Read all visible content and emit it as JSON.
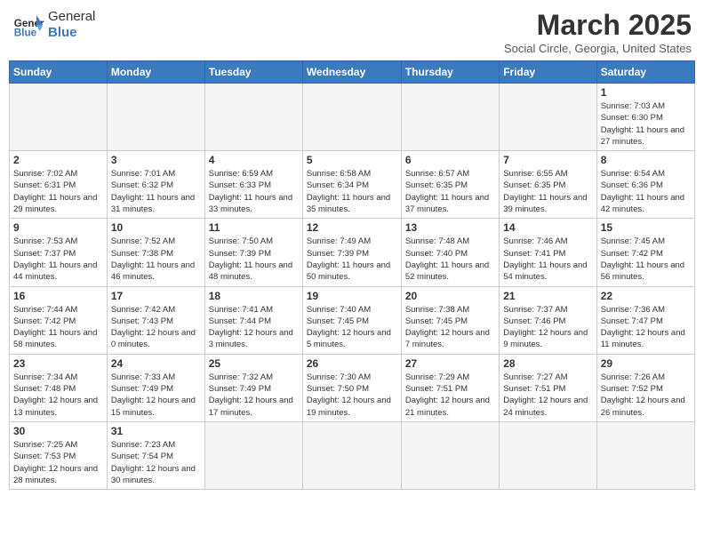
{
  "header": {
    "logo_text_normal": "General",
    "logo_text_blue": "Blue",
    "month_title": "March 2025",
    "location": "Social Circle, Georgia, United States"
  },
  "days_of_week": [
    "Sunday",
    "Monday",
    "Tuesday",
    "Wednesday",
    "Thursday",
    "Friday",
    "Saturday"
  ],
  "weeks": [
    [
      {
        "num": "",
        "info": ""
      },
      {
        "num": "",
        "info": ""
      },
      {
        "num": "",
        "info": ""
      },
      {
        "num": "",
        "info": ""
      },
      {
        "num": "",
        "info": ""
      },
      {
        "num": "",
        "info": ""
      },
      {
        "num": "1",
        "info": "Sunrise: 7:03 AM\nSunset: 6:30 PM\nDaylight: 11 hours and 27 minutes."
      }
    ],
    [
      {
        "num": "2",
        "info": "Sunrise: 7:02 AM\nSunset: 6:31 PM\nDaylight: 11 hours and 29 minutes."
      },
      {
        "num": "3",
        "info": "Sunrise: 7:01 AM\nSunset: 6:32 PM\nDaylight: 11 hours and 31 minutes."
      },
      {
        "num": "4",
        "info": "Sunrise: 6:59 AM\nSunset: 6:33 PM\nDaylight: 11 hours and 33 minutes."
      },
      {
        "num": "5",
        "info": "Sunrise: 6:58 AM\nSunset: 6:34 PM\nDaylight: 11 hours and 35 minutes."
      },
      {
        "num": "6",
        "info": "Sunrise: 6:57 AM\nSunset: 6:35 PM\nDaylight: 11 hours and 37 minutes."
      },
      {
        "num": "7",
        "info": "Sunrise: 6:55 AM\nSunset: 6:35 PM\nDaylight: 11 hours and 39 minutes."
      },
      {
        "num": "8",
        "info": "Sunrise: 6:54 AM\nSunset: 6:36 PM\nDaylight: 11 hours and 42 minutes."
      }
    ],
    [
      {
        "num": "9",
        "info": "Sunrise: 7:53 AM\nSunset: 7:37 PM\nDaylight: 11 hours and 44 minutes."
      },
      {
        "num": "10",
        "info": "Sunrise: 7:52 AM\nSunset: 7:38 PM\nDaylight: 11 hours and 46 minutes."
      },
      {
        "num": "11",
        "info": "Sunrise: 7:50 AM\nSunset: 7:39 PM\nDaylight: 11 hours and 48 minutes."
      },
      {
        "num": "12",
        "info": "Sunrise: 7:49 AM\nSunset: 7:39 PM\nDaylight: 11 hours and 50 minutes."
      },
      {
        "num": "13",
        "info": "Sunrise: 7:48 AM\nSunset: 7:40 PM\nDaylight: 11 hours and 52 minutes."
      },
      {
        "num": "14",
        "info": "Sunrise: 7:46 AM\nSunset: 7:41 PM\nDaylight: 11 hours and 54 minutes."
      },
      {
        "num": "15",
        "info": "Sunrise: 7:45 AM\nSunset: 7:42 PM\nDaylight: 11 hours and 56 minutes."
      }
    ],
    [
      {
        "num": "16",
        "info": "Sunrise: 7:44 AM\nSunset: 7:42 PM\nDaylight: 11 hours and 58 minutes."
      },
      {
        "num": "17",
        "info": "Sunrise: 7:42 AM\nSunset: 7:43 PM\nDaylight: 12 hours and 0 minutes."
      },
      {
        "num": "18",
        "info": "Sunrise: 7:41 AM\nSunset: 7:44 PM\nDaylight: 12 hours and 3 minutes."
      },
      {
        "num": "19",
        "info": "Sunrise: 7:40 AM\nSunset: 7:45 PM\nDaylight: 12 hours and 5 minutes."
      },
      {
        "num": "20",
        "info": "Sunrise: 7:38 AM\nSunset: 7:45 PM\nDaylight: 12 hours and 7 minutes."
      },
      {
        "num": "21",
        "info": "Sunrise: 7:37 AM\nSunset: 7:46 PM\nDaylight: 12 hours and 9 minutes."
      },
      {
        "num": "22",
        "info": "Sunrise: 7:36 AM\nSunset: 7:47 PM\nDaylight: 12 hours and 11 minutes."
      }
    ],
    [
      {
        "num": "23",
        "info": "Sunrise: 7:34 AM\nSunset: 7:48 PM\nDaylight: 12 hours and 13 minutes."
      },
      {
        "num": "24",
        "info": "Sunrise: 7:33 AM\nSunset: 7:49 PM\nDaylight: 12 hours and 15 minutes."
      },
      {
        "num": "25",
        "info": "Sunrise: 7:32 AM\nSunset: 7:49 PM\nDaylight: 12 hours and 17 minutes."
      },
      {
        "num": "26",
        "info": "Sunrise: 7:30 AM\nSunset: 7:50 PM\nDaylight: 12 hours and 19 minutes."
      },
      {
        "num": "27",
        "info": "Sunrise: 7:29 AM\nSunset: 7:51 PM\nDaylight: 12 hours and 21 minutes."
      },
      {
        "num": "28",
        "info": "Sunrise: 7:27 AM\nSunset: 7:51 PM\nDaylight: 12 hours and 24 minutes."
      },
      {
        "num": "29",
        "info": "Sunrise: 7:26 AM\nSunset: 7:52 PM\nDaylight: 12 hours and 26 minutes."
      }
    ],
    [
      {
        "num": "30",
        "info": "Sunrise: 7:25 AM\nSunset: 7:53 PM\nDaylight: 12 hours and 28 minutes."
      },
      {
        "num": "31",
        "info": "Sunrise: 7:23 AM\nSunset: 7:54 PM\nDaylight: 12 hours and 30 minutes."
      },
      {
        "num": "",
        "info": ""
      },
      {
        "num": "",
        "info": ""
      },
      {
        "num": "",
        "info": ""
      },
      {
        "num": "",
        "info": ""
      },
      {
        "num": "",
        "info": ""
      }
    ]
  ]
}
